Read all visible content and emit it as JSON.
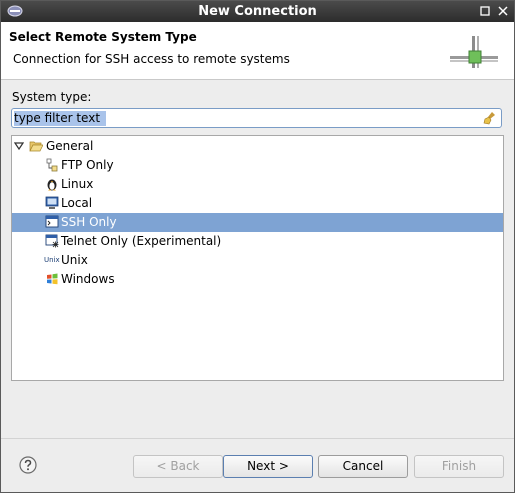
{
  "window": {
    "title": "New Connection",
    "controls": [
      "minimize-icon",
      "close-icon"
    ]
  },
  "header": {
    "title": "Select Remote System Type",
    "description": "Connection for SSH access to remote systems",
    "banner_icon": "network-connection-icon"
  },
  "system_type": {
    "label": "System type:",
    "filter_value": "type filter text",
    "clear_icon": "clear-filter-broom-icon"
  },
  "tree": {
    "category": {
      "label": "General",
      "icon": "folder-open-icon",
      "expanded": true
    },
    "items": [
      {
        "label": "FTP Only",
        "icon": "ftp-icon",
        "selected": false
      },
      {
        "label": "Linux",
        "icon": "linux-penguin-icon",
        "selected": false
      },
      {
        "label": "Local",
        "icon": "local-monitor-icon",
        "selected": false
      },
      {
        "label": "SSH Only",
        "icon": "ssh-terminal-icon",
        "selected": true
      },
      {
        "label": "Telnet Only (Experimental)",
        "icon": "telnet-terminal-icon",
        "selected": false
      },
      {
        "label": "Unix",
        "icon": "unix-icon",
        "icon_text": "Unix",
        "selected": false
      },
      {
        "label": "Windows",
        "icon": "windows-icon",
        "selected": false
      }
    ]
  },
  "buttons": {
    "help_icon": "help-icon",
    "back": {
      "label": "< Back",
      "enabled": false
    },
    "next": {
      "label": "Next >",
      "enabled": true
    },
    "cancel": {
      "label": "Cancel",
      "enabled": true
    },
    "finish": {
      "label": "Finish",
      "enabled": false
    }
  },
  "colors": {
    "selection": "#7ea3d3",
    "titlebar": "#3a3a3a",
    "filter_highlight": "#a9c3ea"
  }
}
